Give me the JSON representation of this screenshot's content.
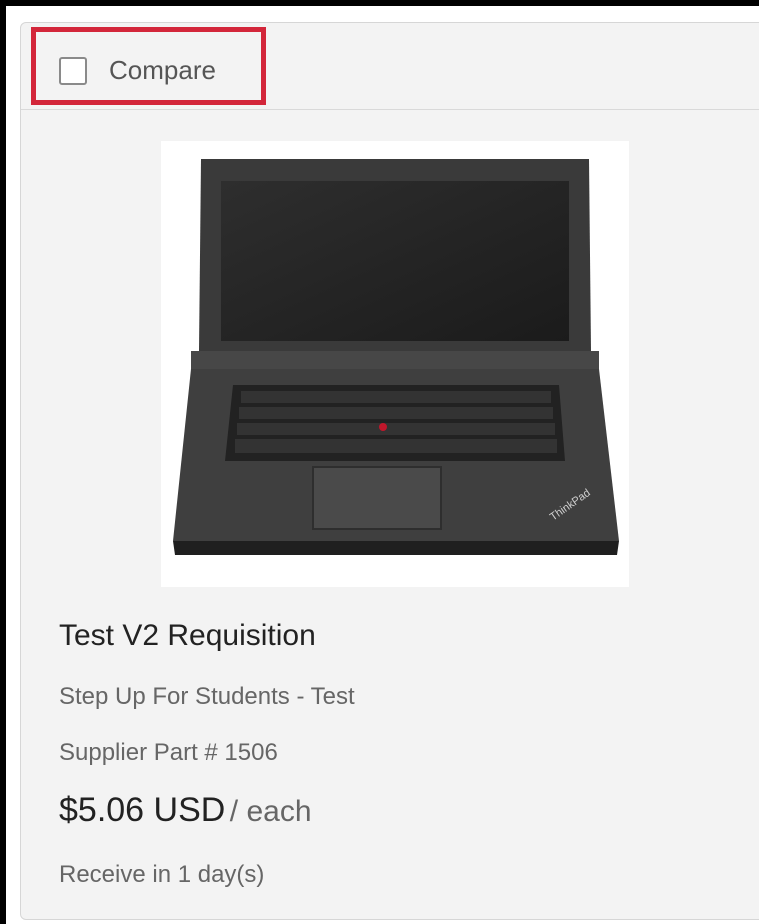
{
  "compare": {
    "label": "Compare",
    "checked": false
  },
  "product": {
    "image_icon": "laptop-image",
    "title": "Test V2 Requisition",
    "supplier": "Step Up For Students - Test",
    "part_number": "Supplier Part # 1506",
    "price": "$5.06 USD",
    "unit": "/ each",
    "delivery": "Receive in 1 day(s)"
  },
  "colors": {
    "highlight": "#d3263a",
    "card_background": "#f3f3f3"
  }
}
